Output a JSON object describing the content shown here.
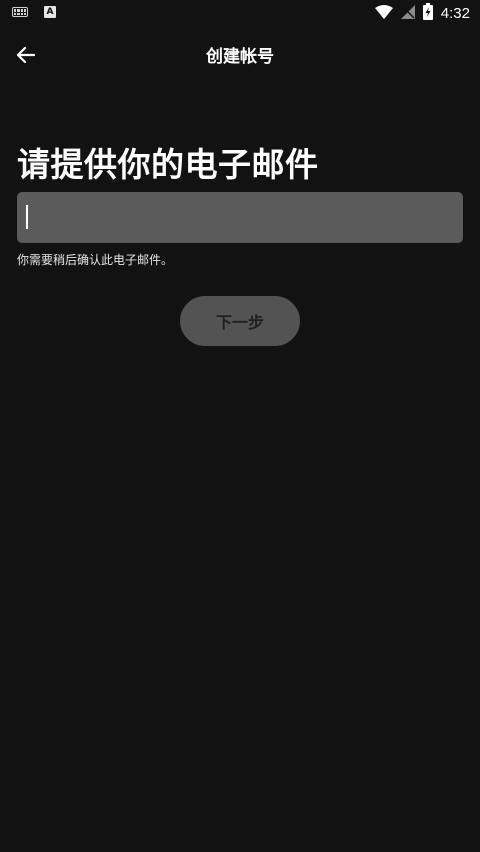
{
  "status_bar": {
    "time": "4:32",
    "left_icons": [
      "keyboard-icon",
      "a-notification-icon"
    ],
    "right_icons": [
      "wifi-icon",
      "no-signal-icon",
      "battery-charging-icon"
    ]
  },
  "app_bar": {
    "title": "创建帐号",
    "back_icon": "arrow-left-icon"
  },
  "main": {
    "heading": "请提供你的电子邮件",
    "email": {
      "value": "",
      "placeholder": ""
    },
    "hint": "你需要稍后确认此电子邮件。",
    "next_label": "下一步"
  },
  "colors": {
    "background": "#121212",
    "field_background": "#5b5b5b",
    "button_background": "#535353",
    "button_text": "#1f1f1f",
    "text": "#ffffff"
  }
}
